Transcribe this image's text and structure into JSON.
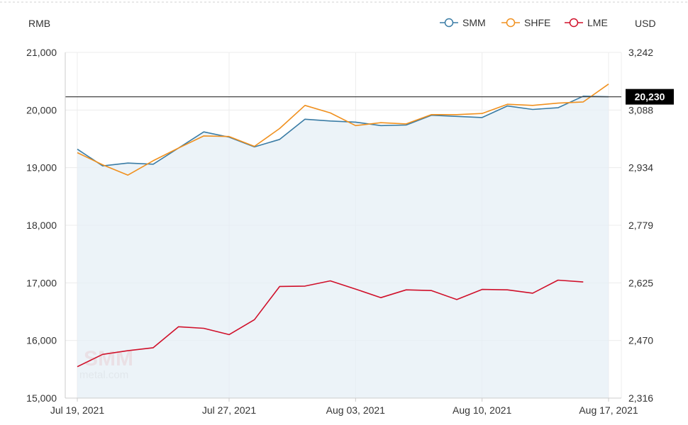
{
  "chart_data": {
    "type": "line",
    "left_unit": "RMB",
    "right_unit": "USD",
    "yticks_left": [
      "21,000",
      "20,000",
      "19,000",
      "18,000",
      "17,000",
      "16,000",
      "15,000"
    ],
    "yticks_right": [
      "3,242",
      "3,088",
      "2,934",
      "2,779",
      "2,625",
      "2,470",
      "2,316"
    ],
    "ylim_left": [
      15000,
      21000
    ],
    "ylim_right": [
      2316,
      3242
    ],
    "xticks": [
      {
        "label": "Jul 19, 2021",
        "index": 0
      },
      {
        "label": "Jul 27, 2021",
        "index": 6
      },
      {
        "label": "Aug 03, 2021",
        "index": 11
      },
      {
        "label": "Aug 10, 2021",
        "index": 16
      },
      {
        "label": "Aug 17, 2021",
        "index": 21
      }
    ],
    "x": [
      "2021-07-19",
      "2021-07-20",
      "2021-07-21",
      "2021-07-22",
      "2021-07-23",
      "2021-07-26",
      "2021-07-27",
      "2021-07-28",
      "2021-07-29",
      "2021-07-30",
      "2021-08-02",
      "2021-08-03",
      "2021-08-04",
      "2021-08-05",
      "2021-08-06",
      "2021-08-09",
      "2021-08-10",
      "2021-08-11",
      "2021-08-12",
      "2021-08-13",
      "2021-08-16",
      "2021-08-17"
    ],
    "series": [
      {
        "name": "SMM",
        "color": "#3a7ca5",
        "axis": "left",
        "area": true,
        "values": [
          19320,
          19030,
          19080,
          19060,
          19340,
          19620,
          19530,
          19360,
          19490,
          19840,
          19810,
          19790,
          19730,
          19740,
          19910,
          19890,
          19870,
          20070,
          20010,
          20040,
          20240,
          20230
        ]
      },
      {
        "name": "SHFE",
        "color": "#f0901e",
        "axis": "left",
        "area": false,
        "values": [
          19260,
          19050,
          18870,
          19120,
          19340,
          19550,
          19540,
          19370,
          19680,
          20080,
          19950,
          19730,
          19780,
          19760,
          19920,
          19920,
          19940,
          20100,
          20080,
          20120,
          20140,
          20450
        ]
      },
      {
        "name": "LME",
        "color": "#d0102a",
        "axis": "right",
        "area": false,
        "values": [
          2400,
          2433,
          2443,
          2451,
          2507,
          2503,
          2486,
          2526,
          2615,
          2616,
          2630,
          2608,
          2585,
          2606,
          2604,
          2580,
          2607,
          2606,
          2597,
          2632,
          2627
        ]
      }
    ],
    "reference_line": {
      "value": 20230,
      "label": "20,230"
    },
    "legend_position": "top-right",
    "grid": true
  }
}
